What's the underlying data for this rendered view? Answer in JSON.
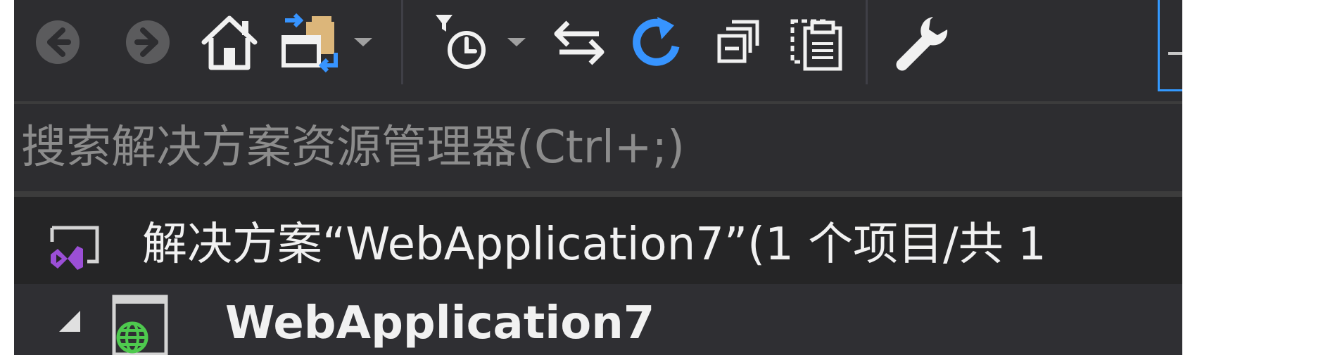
{
  "toolbar": {
    "buttons": [
      {
        "name": "back",
        "icon": "arrow-left-circle-icon"
      },
      {
        "name": "forward",
        "icon": "arrow-right-circle-icon"
      },
      {
        "name": "home",
        "icon": "home-icon"
      },
      {
        "name": "switch-views",
        "icon": "switch-views-icon"
      },
      {
        "name": "pending-changes-filter",
        "icon": "clock-filter-icon"
      },
      {
        "name": "sync-with-active-document",
        "icon": "sync-arrows-icon"
      },
      {
        "name": "refresh",
        "icon": "refresh-icon"
      },
      {
        "name": "collapse-all",
        "icon": "collapse-all-icon"
      },
      {
        "name": "show-all-files",
        "icon": "show-all-files-icon"
      },
      {
        "name": "properties",
        "icon": "wrench-icon"
      }
    ],
    "accent_color": "#3399ff",
    "refresh_color": "#3794ff"
  },
  "search": {
    "placeholder": "搜索解决方案资源管理器(Ctrl+;)"
  },
  "tree": {
    "solution": {
      "label": "解决方案“WebApplication7”(1 个项目/共 1",
      "icon": "visual-studio-solution-icon"
    },
    "project": {
      "label": "WebApplication7",
      "icon": "web-project-globe-icon",
      "expanded": true
    }
  },
  "colors": {
    "panel_background": "#252526",
    "toolbar_background": "#2d2d30",
    "text": "#f1f1f1",
    "placeholder": "#8c8c8c",
    "vs_purple": "#9b4fd6",
    "globe_green": "#4ec94e"
  }
}
